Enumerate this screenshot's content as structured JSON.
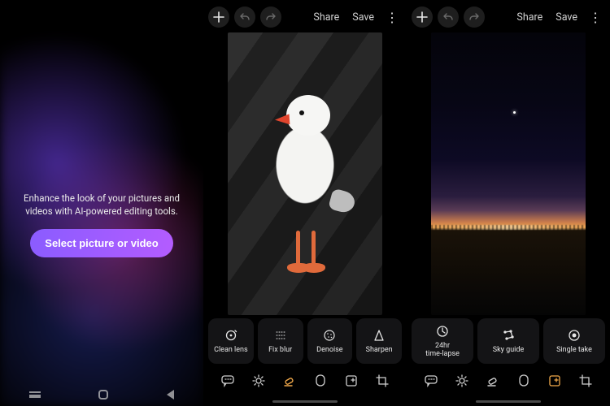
{
  "intro": {
    "tagline": "Enhance the look of your pictures and videos with AI-powered editing tools.",
    "cta": "Select picture or video"
  },
  "topbar": {
    "share": "Share",
    "save": "Save"
  },
  "editor_a": {
    "tools": [
      {
        "key": "clean-lens",
        "label": "Clean lens"
      },
      {
        "key": "fix-blur",
        "label": "Fix blur"
      },
      {
        "key": "denoise",
        "label": "Denoise"
      },
      {
        "key": "sharpen",
        "label": "Sharpen"
      }
    ],
    "active_tab": "eraser"
  },
  "editor_b": {
    "tools": [
      {
        "key": "timelapse",
        "label": "24hr\ntime-lapse"
      },
      {
        "key": "sky-guide",
        "label": "Sky guide"
      },
      {
        "key": "single-take",
        "label": "Single take"
      }
    ],
    "active_tab": "generative"
  },
  "tabs": [
    "chat",
    "adjust",
    "eraser",
    "mask",
    "generative",
    "crop"
  ]
}
